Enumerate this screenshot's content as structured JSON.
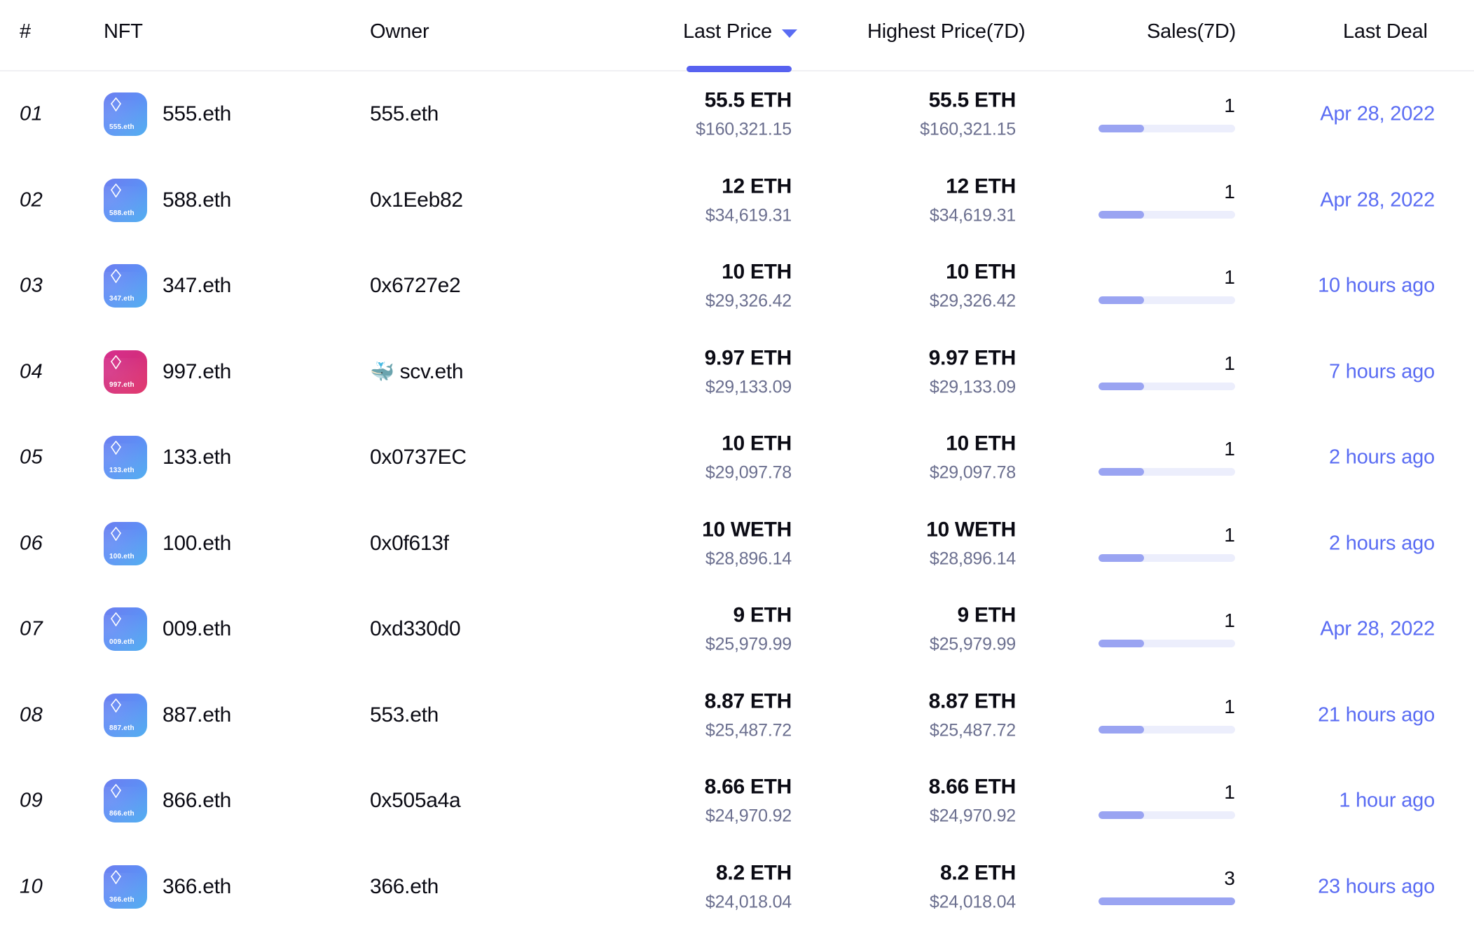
{
  "table": {
    "columns": {
      "rank": "#",
      "nft": "NFT",
      "owner": "Owner",
      "last_price": "Last Price",
      "highest_price": "Highest Price(7D)",
      "sales": "Sales(7D)",
      "last_deal": "Last Deal"
    },
    "sort": {
      "active_column": "Last Price",
      "direction_icon": "chevron-down-icon"
    },
    "sales_max": 3,
    "rows": [
      {
        "rank": "01",
        "nft_name": "555.eth",
        "avatar_label": "555.eth",
        "avatar_color": "blue",
        "owner": "555.eth",
        "owner_emoji": "",
        "last_price_eth": "55.5 ETH",
        "last_price_usd": "$160,321.15",
        "highest_price_eth": "55.5 ETH",
        "highest_price_usd": "$160,321.15",
        "sales": "1",
        "sales_value": 1,
        "last_deal": "Apr 28, 2022"
      },
      {
        "rank": "02",
        "nft_name": "588.eth",
        "avatar_label": "588.eth",
        "avatar_color": "blue",
        "owner": "0x1Eeb82",
        "owner_emoji": "",
        "last_price_eth": "12 ETH",
        "last_price_usd": "$34,619.31",
        "highest_price_eth": "12 ETH",
        "highest_price_usd": "$34,619.31",
        "sales": "1",
        "sales_value": 1,
        "last_deal": "Apr 28, 2022"
      },
      {
        "rank": "03",
        "nft_name": "347.eth",
        "avatar_label": "347.eth",
        "avatar_color": "blue",
        "owner": "0x6727e2",
        "owner_emoji": "",
        "last_price_eth": "10 ETH",
        "last_price_usd": "$29,326.42",
        "highest_price_eth": "10 ETH",
        "highest_price_usd": "$29,326.42",
        "sales": "1",
        "sales_value": 1,
        "last_deal": "10 hours ago"
      },
      {
        "rank": "04",
        "nft_name": "997.eth",
        "avatar_label": "997.eth",
        "avatar_color": "pink",
        "owner": "scv.eth",
        "owner_emoji": "🐳",
        "last_price_eth": "9.97 ETH",
        "last_price_usd": "$29,133.09",
        "highest_price_eth": "9.97 ETH",
        "highest_price_usd": "$29,133.09",
        "sales": "1",
        "sales_value": 1,
        "last_deal": "7 hours ago"
      },
      {
        "rank": "05",
        "nft_name": "133.eth",
        "avatar_label": "133.eth",
        "avatar_color": "blue",
        "owner": "0x0737EC",
        "owner_emoji": "",
        "last_price_eth": "10 ETH",
        "last_price_usd": "$29,097.78",
        "highest_price_eth": "10 ETH",
        "highest_price_usd": "$29,097.78",
        "sales": "1",
        "sales_value": 1,
        "last_deal": "2 hours ago"
      },
      {
        "rank": "06",
        "nft_name": "100.eth",
        "avatar_label": "100.eth",
        "avatar_color": "blue",
        "owner": "0x0f613f",
        "owner_emoji": "",
        "last_price_eth": "10 WETH",
        "last_price_usd": "$28,896.14",
        "highest_price_eth": "10 WETH",
        "highest_price_usd": "$28,896.14",
        "sales": "1",
        "sales_value": 1,
        "last_deal": "2 hours ago"
      },
      {
        "rank": "07",
        "nft_name": "009.eth",
        "avatar_label": "009.eth",
        "avatar_color": "blue",
        "owner": "0xd330d0",
        "owner_emoji": "",
        "last_price_eth": "9 ETH",
        "last_price_usd": "$25,979.99",
        "highest_price_eth": "9 ETH",
        "highest_price_usd": "$25,979.99",
        "sales": "1",
        "sales_value": 1,
        "last_deal": "Apr 28, 2022"
      },
      {
        "rank": "08",
        "nft_name": "887.eth",
        "avatar_label": "887.eth",
        "avatar_color": "blue",
        "owner": "553.eth",
        "owner_emoji": "",
        "last_price_eth": "8.87 ETH",
        "last_price_usd": "$25,487.72",
        "highest_price_eth": "8.87 ETH",
        "highest_price_usd": "$25,487.72",
        "sales": "1",
        "sales_value": 1,
        "last_deal": "21 hours ago"
      },
      {
        "rank": "09",
        "nft_name": "866.eth",
        "avatar_label": "866.eth",
        "avatar_color": "blue",
        "owner": "0x505a4a",
        "owner_emoji": "",
        "last_price_eth": "8.66 ETH",
        "last_price_usd": "$24,970.92",
        "highest_price_eth": "8.66 ETH",
        "highest_price_usd": "$24,970.92",
        "sales": "1",
        "sales_value": 1,
        "last_deal": "1 hour ago"
      },
      {
        "rank": "10",
        "nft_name": "366.eth",
        "avatar_label": "366.eth",
        "avatar_color": "blue",
        "owner": "366.eth",
        "owner_emoji": "",
        "last_price_eth": "8.2 ETH",
        "last_price_usd": "$24,018.04",
        "highest_price_eth": "8.2 ETH",
        "highest_price_usd": "$24,018.04",
        "sales": "3",
        "sales_value": 3,
        "last_deal": "23 hours ago"
      }
    ]
  },
  "colors": {
    "accent": "#5a6cf3",
    "accent_bar": "#5762f0",
    "bar_fill": "#9aa4f2",
    "bar_track": "#eceefc",
    "text_primary": "#0b0b14",
    "text_muted": "#6b6f8f"
  }
}
